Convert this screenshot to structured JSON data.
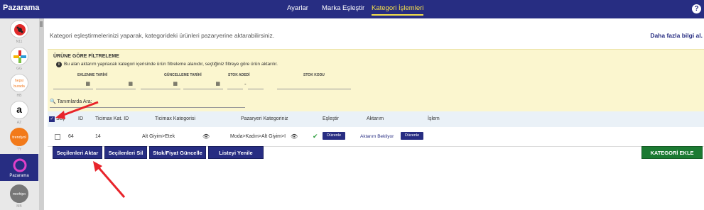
{
  "topbar": {
    "brand": "Pazarama",
    "tabs": [
      {
        "label": "Ayarlar"
      },
      {
        "label": "Marka Eşleştir"
      },
      {
        "label": "Kategori İşlemleri"
      }
    ],
    "help": "?"
  },
  "sidebar": {
    "items": [
      {
        "code": "N11",
        "icon": "n11-logo"
      },
      {
        "code": "GG",
        "icon": "gittigidiyor-logo"
      },
      {
        "code": "HB",
        "icon": "hepsiburada-logo",
        "logo_text": "hepsi burada"
      },
      {
        "code": "AZ",
        "icon": "amazon-logo",
        "logo_text": "a"
      },
      {
        "code": "TY",
        "icon": "trendyol-logo",
        "logo_text": "trendyol"
      },
      {
        "code": "Pazarama",
        "icon": "pazarama-logo"
      },
      {
        "code": "MB",
        "icon": "morhipo-logo",
        "logo_text": "morhipo"
      }
    ]
  },
  "intro": "Kategori eşleştirmelerinizi yaparak, kategorideki ürünleri pazaryerine aktarabilirsiniz.",
  "more_link": "Daha fazla bilgi al.",
  "filter": {
    "title": "ÜRÜNE GÖRE FİLTRELEME",
    "info": "Bu alan aktarım yapılacak kategori içerisinde ürün filtreleme alanıdır, seçtiğiniz filtreye göre ürün aktarılır.",
    "labels": {
      "created": "EKLENME TARİHİ",
      "updated": "GÜNCELLEME TARİHİ",
      "stock": "STOK ADEDİ",
      "stock_code": "STOK KODU"
    }
  },
  "search": {
    "label": "Tanımlarda Ara:"
  },
  "table": {
    "headers": [
      "Seç",
      "ID",
      "Ticimax Kat. ID",
      "Ticimax Kategorisi",
      "Pazaryeri Kategoriniz",
      "Eşleştir",
      "Aktarım",
      "İşlem"
    ],
    "rows": [
      {
        "id": "64",
        "ticimax_id": "14",
        "ticimax_category": "Alt Giyim>Etek",
        "marketplace_category": "Moda>Kadın>Alt Giyim>I",
        "match_button": "Düzenle",
        "transfer_status": "Aktarım Bekliyor",
        "action_button": "Düzenle"
      }
    ]
  },
  "actions": {
    "transfer_selected": "Seçilenleri Aktar",
    "delete_selected": "Seçilenleri Sil",
    "update_stock_price": "Stok/Fiyat Güncelle",
    "refresh_list": "Listeyi Yenile",
    "add_category": "KATEGORİ EKLE"
  },
  "colors": {
    "primary": "#272d82",
    "highlight_tab": "#f5e04b",
    "filter_bg": "#fbf6cf",
    "add_button": "#1b7a32",
    "arrow": "#e8242b"
  }
}
